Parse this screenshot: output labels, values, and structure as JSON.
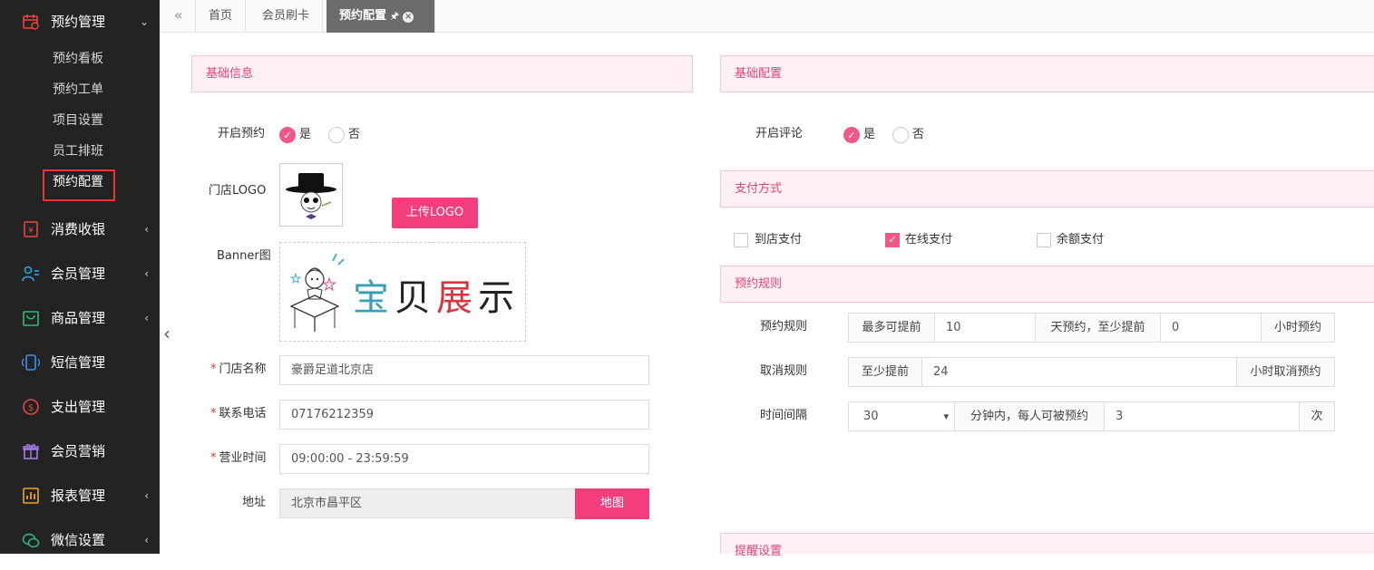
{
  "sidebar": {
    "groups": [
      {
        "label": "预约管理",
        "icon": "calendar-icon",
        "arrow": "⌄"
      },
      {
        "label": "消费收银",
        "icon": "cashier-icon",
        "arrow": "‹"
      },
      {
        "label": "会员管理",
        "icon": "members-icon",
        "arrow": "‹"
      },
      {
        "label": "商品管理",
        "icon": "bag-icon",
        "arrow": "‹"
      },
      {
        "label": "短信管理",
        "icon": "phone-icon",
        "arrow": ""
      },
      {
        "label": "支出管理",
        "icon": "money-icon",
        "arrow": ""
      },
      {
        "label": "会员营销",
        "icon": "gift-icon",
        "arrow": ""
      },
      {
        "label": "报表管理",
        "icon": "report-icon",
        "arrow": "‹"
      },
      {
        "label": "微信设置",
        "icon": "wechat-icon",
        "arrow": "‹"
      }
    ],
    "sub_items": [
      "预约看板",
      "预约工单",
      "项目设置",
      "员工排班",
      "预约配置"
    ]
  },
  "tabs": {
    "collapse": "«",
    "items": [
      "首页",
      "会员刷卡",
      "预约配置"
    ],
    "pin": "🖈",
    "close": "×"
  },
  "collapse_arrow": "‹",
  "basic_info": {
    "title": "基础信息",
    "booking_label": "开启预约",
    "yes": "是",
    "no": "否",
    "logo_label": "门店LOGO",
    "upload_logo": "上传LOGO",
    "banner_label": "Banner图",
    "banner_text": "宝贝展示",
    "store_name_label": "门店名称",
    "store_name": "豪爵足道北京店",
    "phone_label": "联系电话",
    "phone": "07176212359",
    "hours_label": "营业时间",
    "hours": "09:00:00 - 23:59:59",
    "address_label": "地址",
    "address": "北京市昌平区",
    "map_button": "地图",
    "required_mark": "*"
  },
  "basic_config": {
    "title": "基础配置",
    "review_label": "开启评论",
    "yes": "是",
    "no": "否"
  },
  "payment": {
    "title": "支付方式",
    "options": [
      {
        "label": "到店支付",
        "checked": false
      },
      {
        "label": "在线支付",
        "checked": true
      },
      {
        "label": "余额支付",
        "checked": false
      }
    ],
    "check_mark": "✓"
  },
  "rules": {
    "title": "预约规则",
    "booking_rule_label": "预约规则",
    "max_advance": "最多可提前",
    "max_advance_value": "10",
    "days_min_advance": "天预约，至少提前",
    "min_advance_value": "0",
    "hours_booking": "小时预约",
    "cancel_rule_label": "取消规则",
    "at_least": "至少提前",
    "cancel_value": "24",
    "hours_cancel": "小时取消预约",
    "interval_label": "时间间隔",
    "interval_value": "30",
    "interval_arrow": "▾",
    "per_person": "分钟内，每人可被预约",
    "per_person_value": "3",
    "times": "次"
  },
  "reminder": {
    "title": "提醒设置"
  },
  "colors": {
    "accent": "#f33e7d",
    "sidebar_bg": "#232323",
    "section_bg": "#fff0f3",
    "section_text": "#e5427c"
  }
}
